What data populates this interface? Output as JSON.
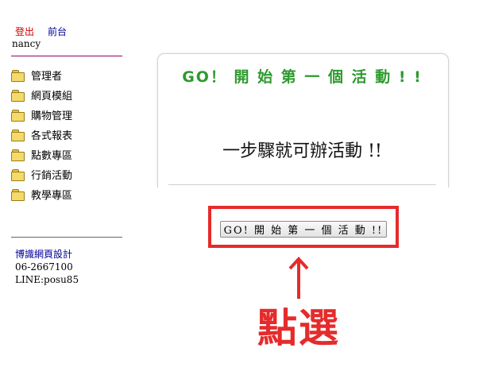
{
  "nav": {
    "logout": "登出",
    "frontend": "前台",
    "username": "nancy"
  },
  "menu": {
    "items": [
      {
        "label": "管理者",
        "icon": "folder-icon"
      },
      {
        "label": "網頁模組",
        "icon": "folder-icon"
      },
      {
        "label": "購物管理",
        "icon": "folder-icon"
      },
      {
        "label": "各式報表",
        "icon": "folder-icon"
      },
      {
        "label": "點數專區",
        "icon": "folder-icon"
      },
      {
        "label": "行銷活動",
        "icon": "folder-icon"
      },
      {
        "label": "教學專區",
        "icon": "folder-icon"
      }
    ]
  },
  "footer": {
    "company": "博識網頁設計",
    "phone": "06-2667100",
    "line": "LINE:posu85"
  },
  "card": {
    "title": "GO！ 開 始 第 一 個 活 動 ! !",
    "subtitle": "一步驟就可辦活動 !!"
  },
  "action": {
    "button_label": "GO! 開 始 第 一 個 活 動 !!",
    "callout": "點選"
  },
  "colors": {
    "highlight": "#e52b2b",
    "title_green": "#2e9a2e",
    "logout_red": "#cc0000",
    "link_blue": "#000099"
  }
}
